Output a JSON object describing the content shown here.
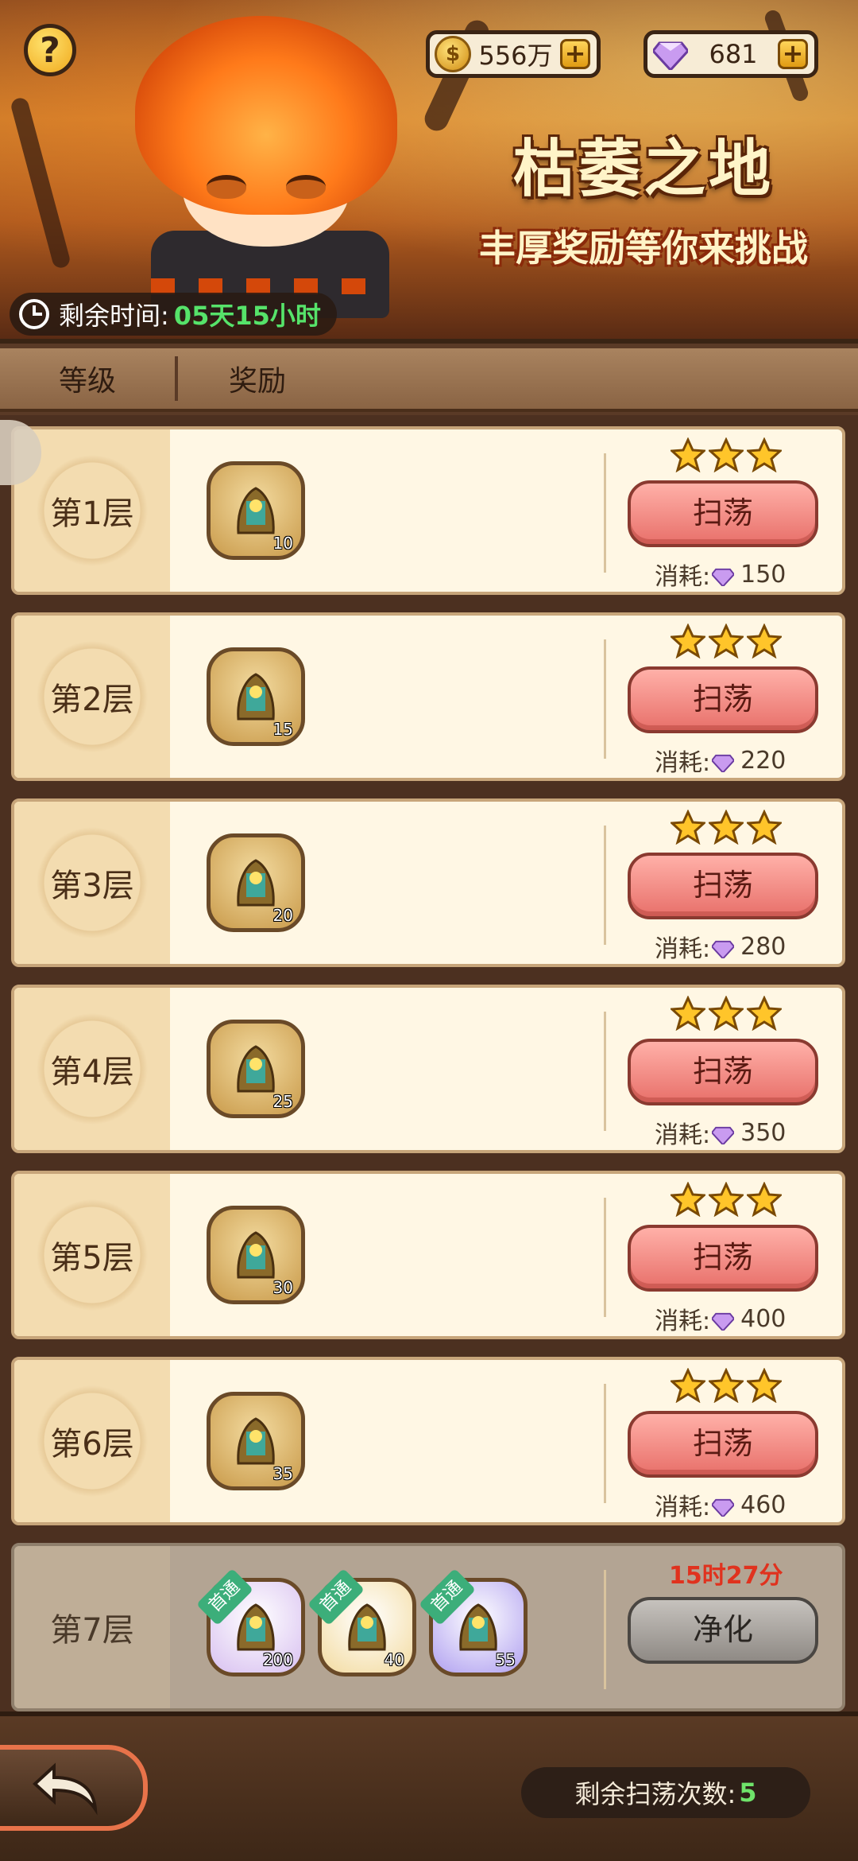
{
  "currency": {
    "gold": "556万",
    "gems": "681"
  },
  "banner": {
    "title": "枯萎之地",
    "subtitle": "丰厚奖励等你来挑战",
    "timer_label": "剩余时间:",
    "timer_value": "05天15小时"
  },
  "header": {
    "level_col": "等级",
    "reward_col": "奖励"
  },
  "rows": [
    {
      "level": "第1层",
      "reward_qty": "10",
      "button": "扫荡",
      "cost_label": "消耗:",
      "cost": "150",
      "stars": 3
    },
    {
      "level": "第2层",
      "reward_qty": "15",
      "button": "扫荡",
      "cost_label": "消耗:",
      "cost": "220",
      "stars": 3
    },
    {
      "level": "第3层",
      "reward_qty": "20",
      "button": "扫荡",
      "cost_label": "消耗:",
      "cost": "280",
      "stars": 3
    },
    {
      "level": "第4层",
      "reward_qty": "25",
      "button": "扫荡",
      "cost_label": "消耗:",
      "cost": "350",
      "stars": 3
    },
    {
      "level": "第5层",
      "reward_qty": "30",
      "button": "扫荡",
      "cost_label": "消耗:",
      "cost": "400",
      "stars": 3
    },
    {
      "level": "第6层",
      "reward_qty": "35",
      "button": "扫荡",
      "cost_label": "消耗:",
      "cost": "460",
      "stars": 3
    }
  ],
  "locked_row": {
    "level": "第7层",
    "cooldown": "15时27分",
    "button": "净化",
    "first_clear_tag": "首通",
    "rewards": [
      "200",
      "40",
      "55"
    ]
  },
  "footer": {
    "sweeps_label": "剩余扫荡次数:",
    "sweeps_count": "5"
  },
  "colors": {
    "accent_green": "#56e36a",
    "cooldown_red": "#e0321e",
    "sweep_button": "#e8706a"
  }
}
